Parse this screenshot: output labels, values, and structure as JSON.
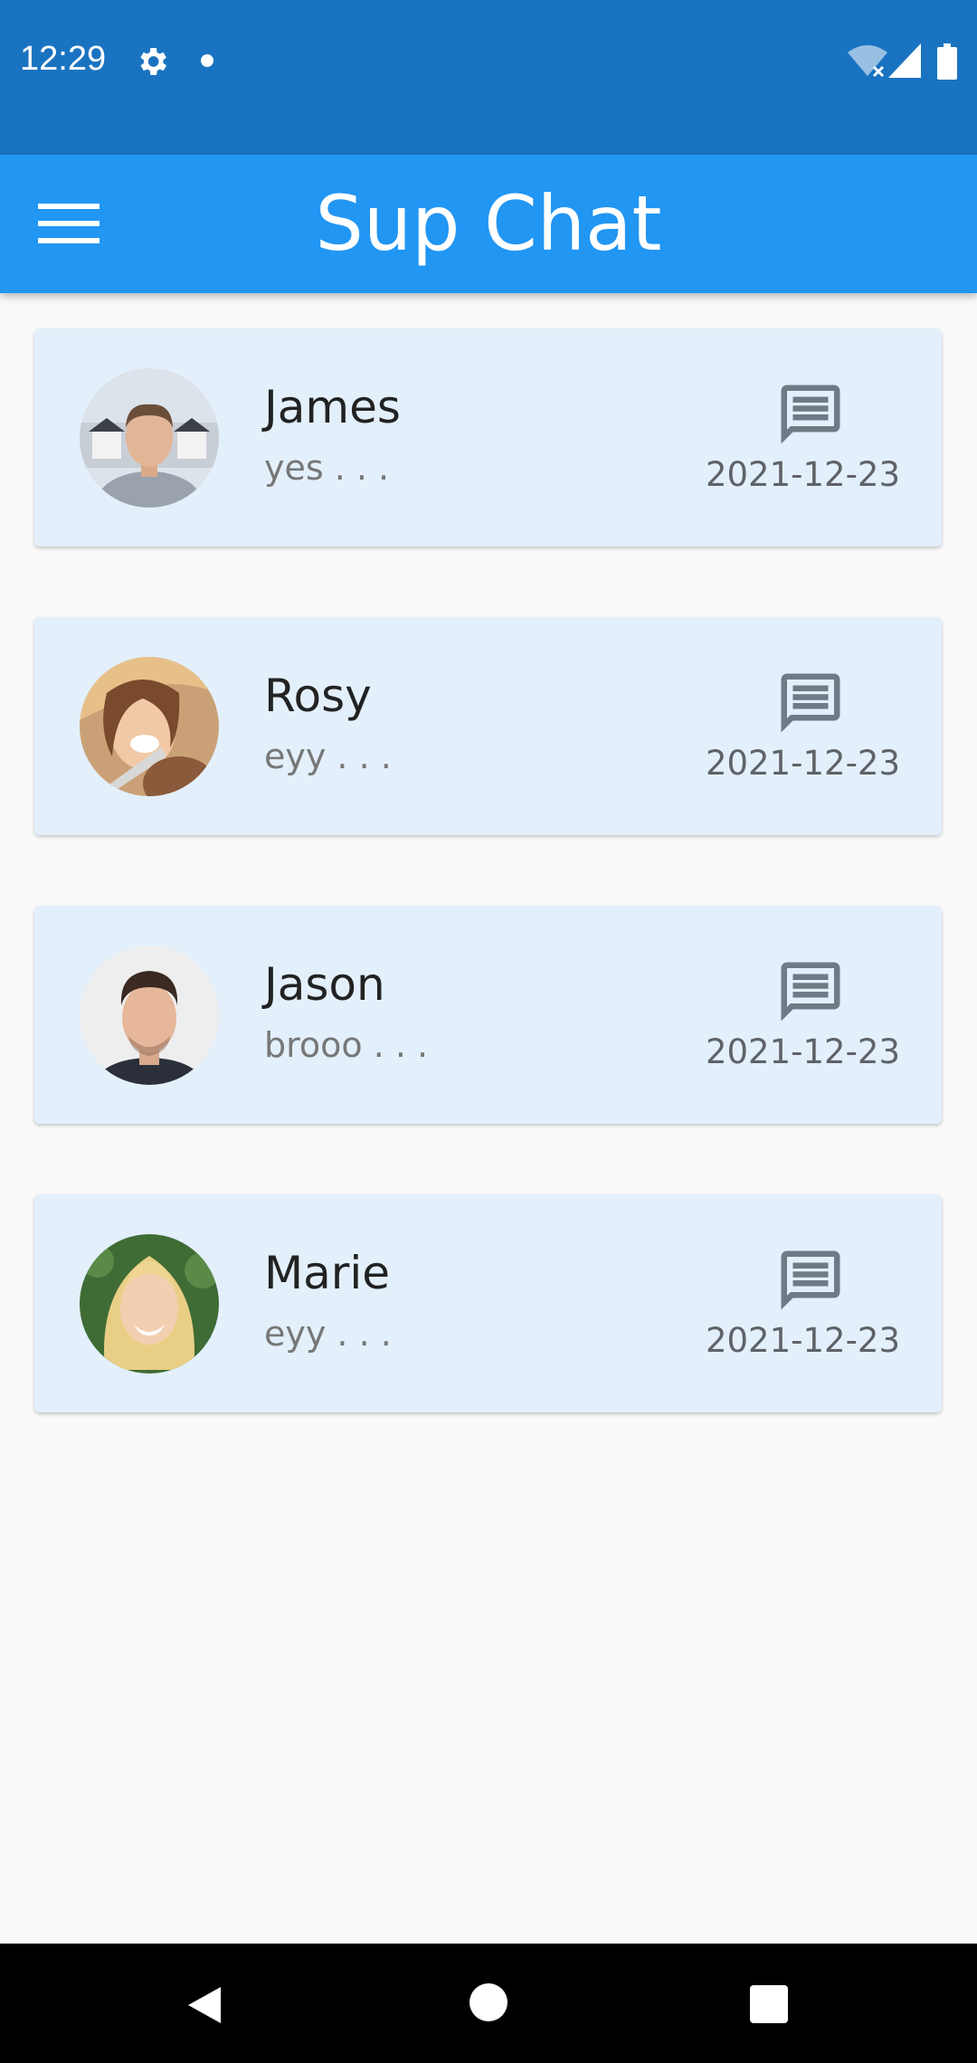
{
  "status_bar": {
    "time": "12:29",
    "icons": [
      "gear-icon",
      "notification-dot-icon",
      "wifi-off-icon",
      "signal-icon",
      "battery-icon"
    ]
  },
  "app_bar": {
    "title": "Sup Chat",
    "menu_icon": "menu-icon",
    "background_color": "#2196f3"
  },
  "chats": [
    {
      "name": "James",
      "preview": "yes . . .",
      "date": "2021-12-23",
      "icon": "message-icon"
    },
    {
      "name": "Rosy",
      "preview": "eyy . . .",
      "date": "2021-12-23",
      "icon": "message-icon"
    },
    {
      "name": "Jason",
      "preview": "brooo . . .",
      "date": "2021-12-23",
      "icon": "message-icon"
    },
    {
      "name": "Marie",
      "preview": "eyy . . .",
      "date": "2021-12-23",
      "icon": "message-icon"
    }
  ],
  "nav_bar": {
    "icons": [
      "back-icon",
      "home-icon",
      "recents-icon"
    ]
  },
  "colors": {
    "status_bar": "#1a73c1",
    "card_background": "#e3f0fc",
    "page_background": "#fafafa"
  }
}
